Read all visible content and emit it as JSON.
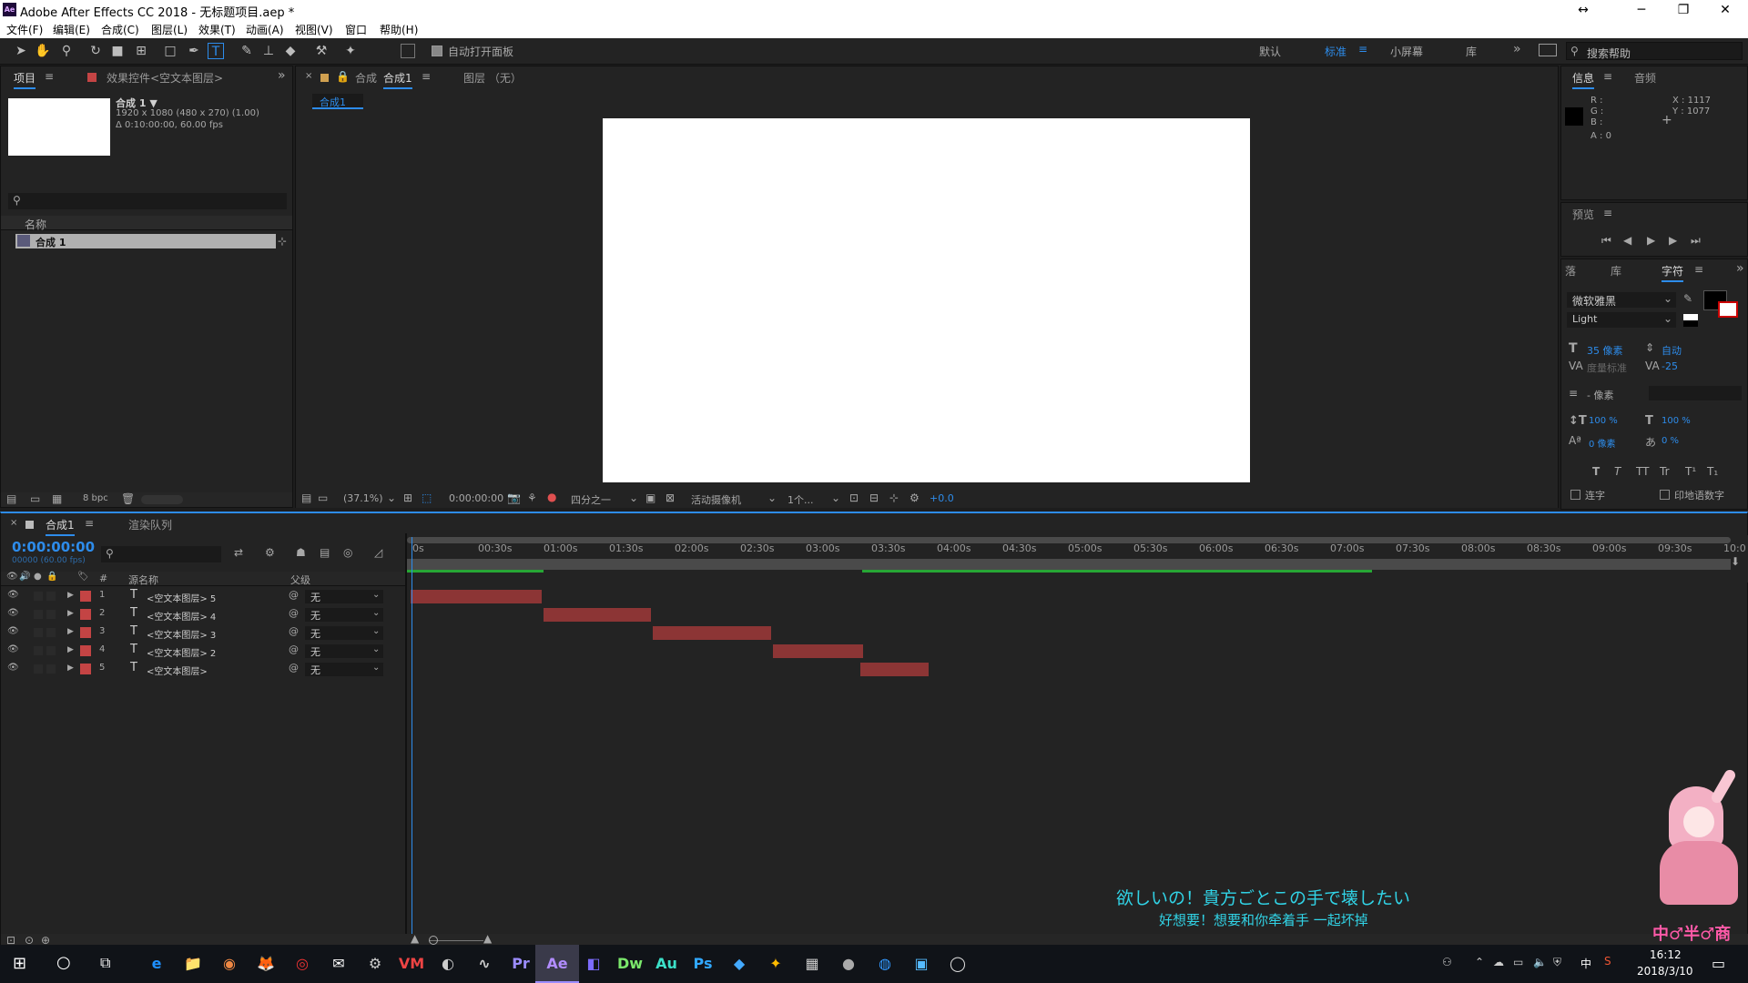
{
  "app": {
    "title": "Adobe After Effects CC 2018 - 无标题项目.aep *",
    "logo": "Ae"
  },
  "window_controls": {
    "restore_extra": "↔",
    "minimize": "─",
    "maximize": "❐",
    "close": "✕"
  },
  "menu": [
    "文件(F)",
    "编辑(E)",
    "合成(C)",
    "图层(L)",
    "效果(T)",
    "动画(A)",
    "视图(V)",
    "窗口",
    "帮助(H)"
  ],
  "toolbar": {
    "auto_open": "自动打开面板",
    "workspaces": [
      "默认",
      "标准",
      "小屏幕",
      "库"
    ],
    "search_placeholder": "搜索帮助"
  },
  "project": {
    "tab": "项目",
    "effects_tab": "效果控件<空文本图层>",
    "comp_name": "合成 1 ▼",
    "comp_info1": "1920 x 1080 (480 x 270) (1.00)",
    "comp_info2": "Δ 0:10:00:00, 60.00 fps",
    "col_name": "名称",
    "item": "合成 1",
    "bpc": "8 bpc"
  },
  "viewer": {
    "tab_prefix": "合成",
    "tab_name": "合成1",
    "layer_tab": "图层 （无）",
    "crumb": "合成1",
    "zoom": "(37.1%)",
    "timecode": "0:00:00:00",
    "resolution": "四分之一",
    "camera": "活动摄像机",
    "views": "1个...",
    "exposure": "+0.0"
  },
  "info": {
    "tab": "信息",
    "audio_tab": "音频",
    "r": "R :",
    "g": "G :",
    "b": "B :",
    "a": "A : 0",
    "x": "X : 1117",
    "y": "Y : 1077"
  },
  "preview": {
    "tab": "预览"
  },
  "character": {
    "tabs": [
      "落",
      "库",
      "字符"
    ],
    "font": "微软雅黑",
    "style": "Light",
    "size": "35 像素",
    "leading": "自动",
    "kerning": "度量标准",
    "tracking": "-25",
    "stroke": "- 像素",
    "vscale": "100 %",
    "hscale": "100 %",
    "baseline": "0 像素",
    "tsume": "0 %",
    "styles": [
      "T",
      "T",
      "TT",
      "Tr",
      "T¹",
      "T₁"
    ],
    "ligatures": "连字",
    "hindi": "印地语数字"
  },
  "timeline": {
    "tab": "合成1",
    "render_tab": "渲染队列",
    "time": "0:00:00:00",
    "frames": "00000 (60.00 fps)",
    "col_num": "#",
    "col_source": "源名称",
    "col_parent": "父级",
    "ticks": [
      "0s",
      "00:30s",
      "01:00s",
      "01:30s",
      "02:00s",
      "02:30s",
      "03:00s",
      "03:30s",
      "04:00s",
      "04:30s",
      "05:00s",
      "05:30s",
      "06:00s",
      "06:30s",
      "07:00s",
      "07:30s",
      "08:00s",
      "08:30s",
      "09:00s",
      "09:30s",
      "10:0"
    ],
    "layers": [
      {
        "num": "1",
        "name": "<空文本图层> 5",
        "parent": "无",
        "start": 0,
        "end": 60
      },
      {
        "num": "2",
        "name": "<空文本图层> 4",
        "parent": "无",
        "start": 61,
        "end": 110
      },
      {
        "num": "3",
        "name": "<空文本图层> 3",
        "parent": "无",
        "start": 111,
        "end": 165
      },
      {
        "num": "4",
        "name": "<空文本图层> 2",
        "parent": "无",
        "start": 166,
        "end": 207
      },
      {
        "num": "5",
        "name": "<空文本图层>",
        "parent": "无",
        "start": 206,
        "end": 237
      }
    ]
  },
  "subtitles": {
    "line1": "欲しいの！貴方ごとこの手で壊したい",
    "line2": "好想要！想要和你牵着手 一起坏掉",
    "watermark": "中♂半♂商"
  },
  "taskbar": {
    "time": "16:12",
    "date": "2018/3/10",
    "ime": "中",
    "apps": [
      "e",
      "📁",
      "◉",
      "🦊",
      "◎",
      "✉",
      "⚙",
      "VM",
      "◐",
      "∿",
      "Pr",
      "Ae",
      "◧",
      "Dw",
      "Au",
      "Ps",
      "◆",
      "✦",
      "▦",
      "●",
      "◍",
      "▣",
      "◯"
    ]
  },
  "colors": {
    "accent": "#2d8ceb",
    "layer_label": "#c44444",
    "bar": "#8c3535",
    "work_area": "#27a635"
  }
}
